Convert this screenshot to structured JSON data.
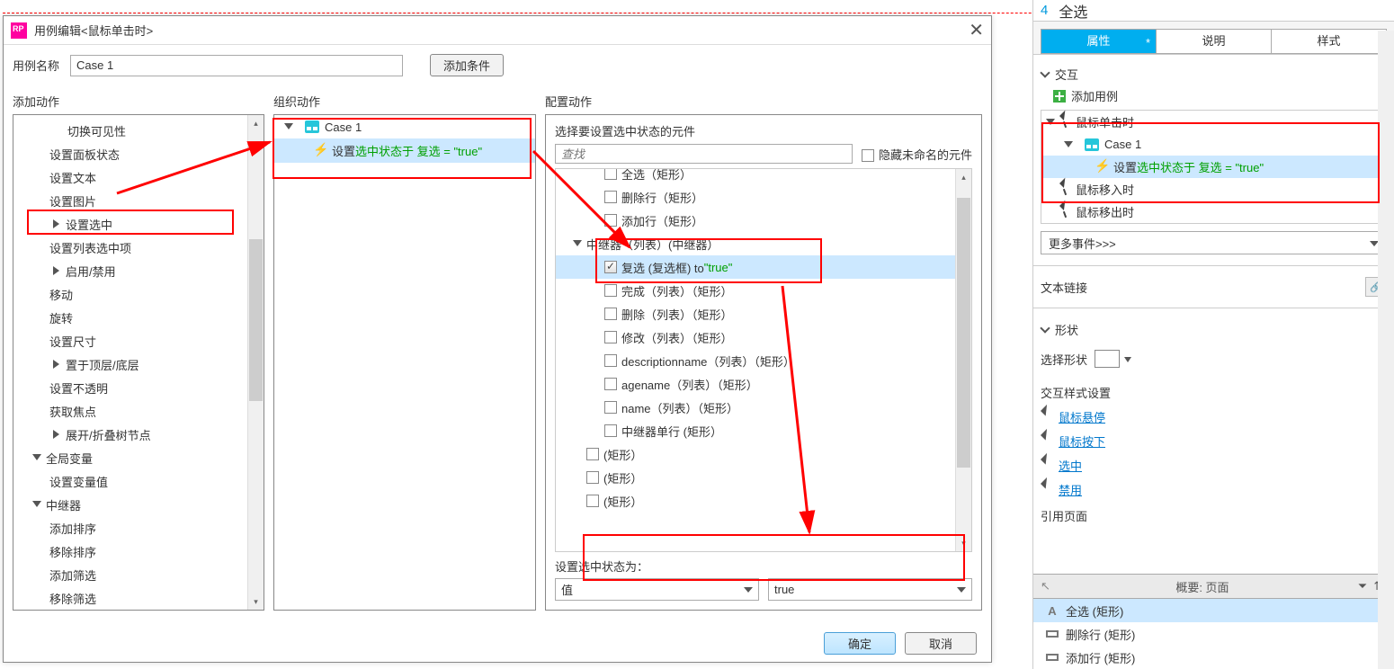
{
  "dialog": {
    "title": "用例编辑<鼠标单击时>",
    "case_name_label": "用例名称",
    "case_name_value": "Case 1",
    "add_condition": "添加条件",
    "ok": "确定",
    "cancel": "取消",
    "col1_header": "添加动作",
    "col2_header": "组织动作",
    "col3_header": "配置动作",
    "actions": {
      "a11": "切换可见性",
      "a12": "设置面板状态",
      "a13": "设置文本",
      "a14": "设置图片",
      "a15": "设置选中",
      "a16": "设置列表选中项",
      "a17": "启用/禁用",
      "a18": "移动",
      "a19": "旋转",
      "a20": "设置尺寸",
      "a21": "置于顶层/底层",
      "a22": "设置不透明",
      "a23": "获取焦点",
      "a24": "展开/折叠树节点",
      "g2": "全局变量",
      "a25": "设置变量值",
      "g3": "中继器",
      "a31": "添加排序",
      "a32": "移除排序",
      "a33": "添加筛选",
      "a34": "移除筛选"
    },
    "org": {
      "case": "Case 1",
      "action_prefix": "设置 ",
      "action_green": "选中状态于 复选 = \"true\""
    },
    "cfg": {
      "label": "选择要设置选中状态的元件",
      "search_ph": "查找",
      "hide_unnamed": "隐藏未命名的元件",
      "set_state_label": "设置选中状态为：",
      "combo1": "值",
      "combo2": "true",
      "rows": {
        "r0": "全选（矩形）",
        "r1": "删除行（矩形）",
        "r2": "添加行（矩形）",
        "r3": "中继器（列表）(中继器）",
        "r4a": "复选 (复选框) to ",
        "r4b": "\"true\"",
        "r5": "完成（列表）（矩形）",
        "r6": "删除（列表）（矩形）",
        "r7": "修改（列表）（矩形）",
        "r8": "descriptionname（列表）（矩形）",
        "r9": "agename（列表）（矩形）",
        "r10": "name（列表）（矩形）",
        "r11": "中继器单行 (矩形）",
        "r12": "(矩形）",
        "r13": "(矩形）",
        "r14": "(矩形）"
      }
    }
  },
  "rpanel": {
    "num": "4",
    "top_title": "全选",
    "tab_attr": "属性",
    "tab_desc": "说明",
    "tab_style": "样式",
    "sect_interact": "交互",
    "add_case": "添加用例",
    "ev_click": "鼠标单击时",
    "ev_case": "Case 1",
    "ev_action_pre": "设置 ",
    "ev_action_green": "选中状态于 复选 = \"true\"",
    "ev_hover": "鼠标移入时",
    "ev_out": "鼠标移出时",
    "more_events": "更多事件>>>",
    "text_link": "文本链接",
    "sect_shape": "形状",
    "select_shape": "选择形状",
    "style_set": "交互样式设置",
    "s_hover": "鼠标悬停",
    "s_down": "鼠标按下",
    "s_sel": "选中",
    "s_dis": "禁用",
    "ref_page": "引用页面",
    "outline": "概要: 页面",
    "ol1": "全选 (矩形)",
    "ol2": "删除行 (矩形)",
    "ol3": "添加行 (矩形)"
  }
}
